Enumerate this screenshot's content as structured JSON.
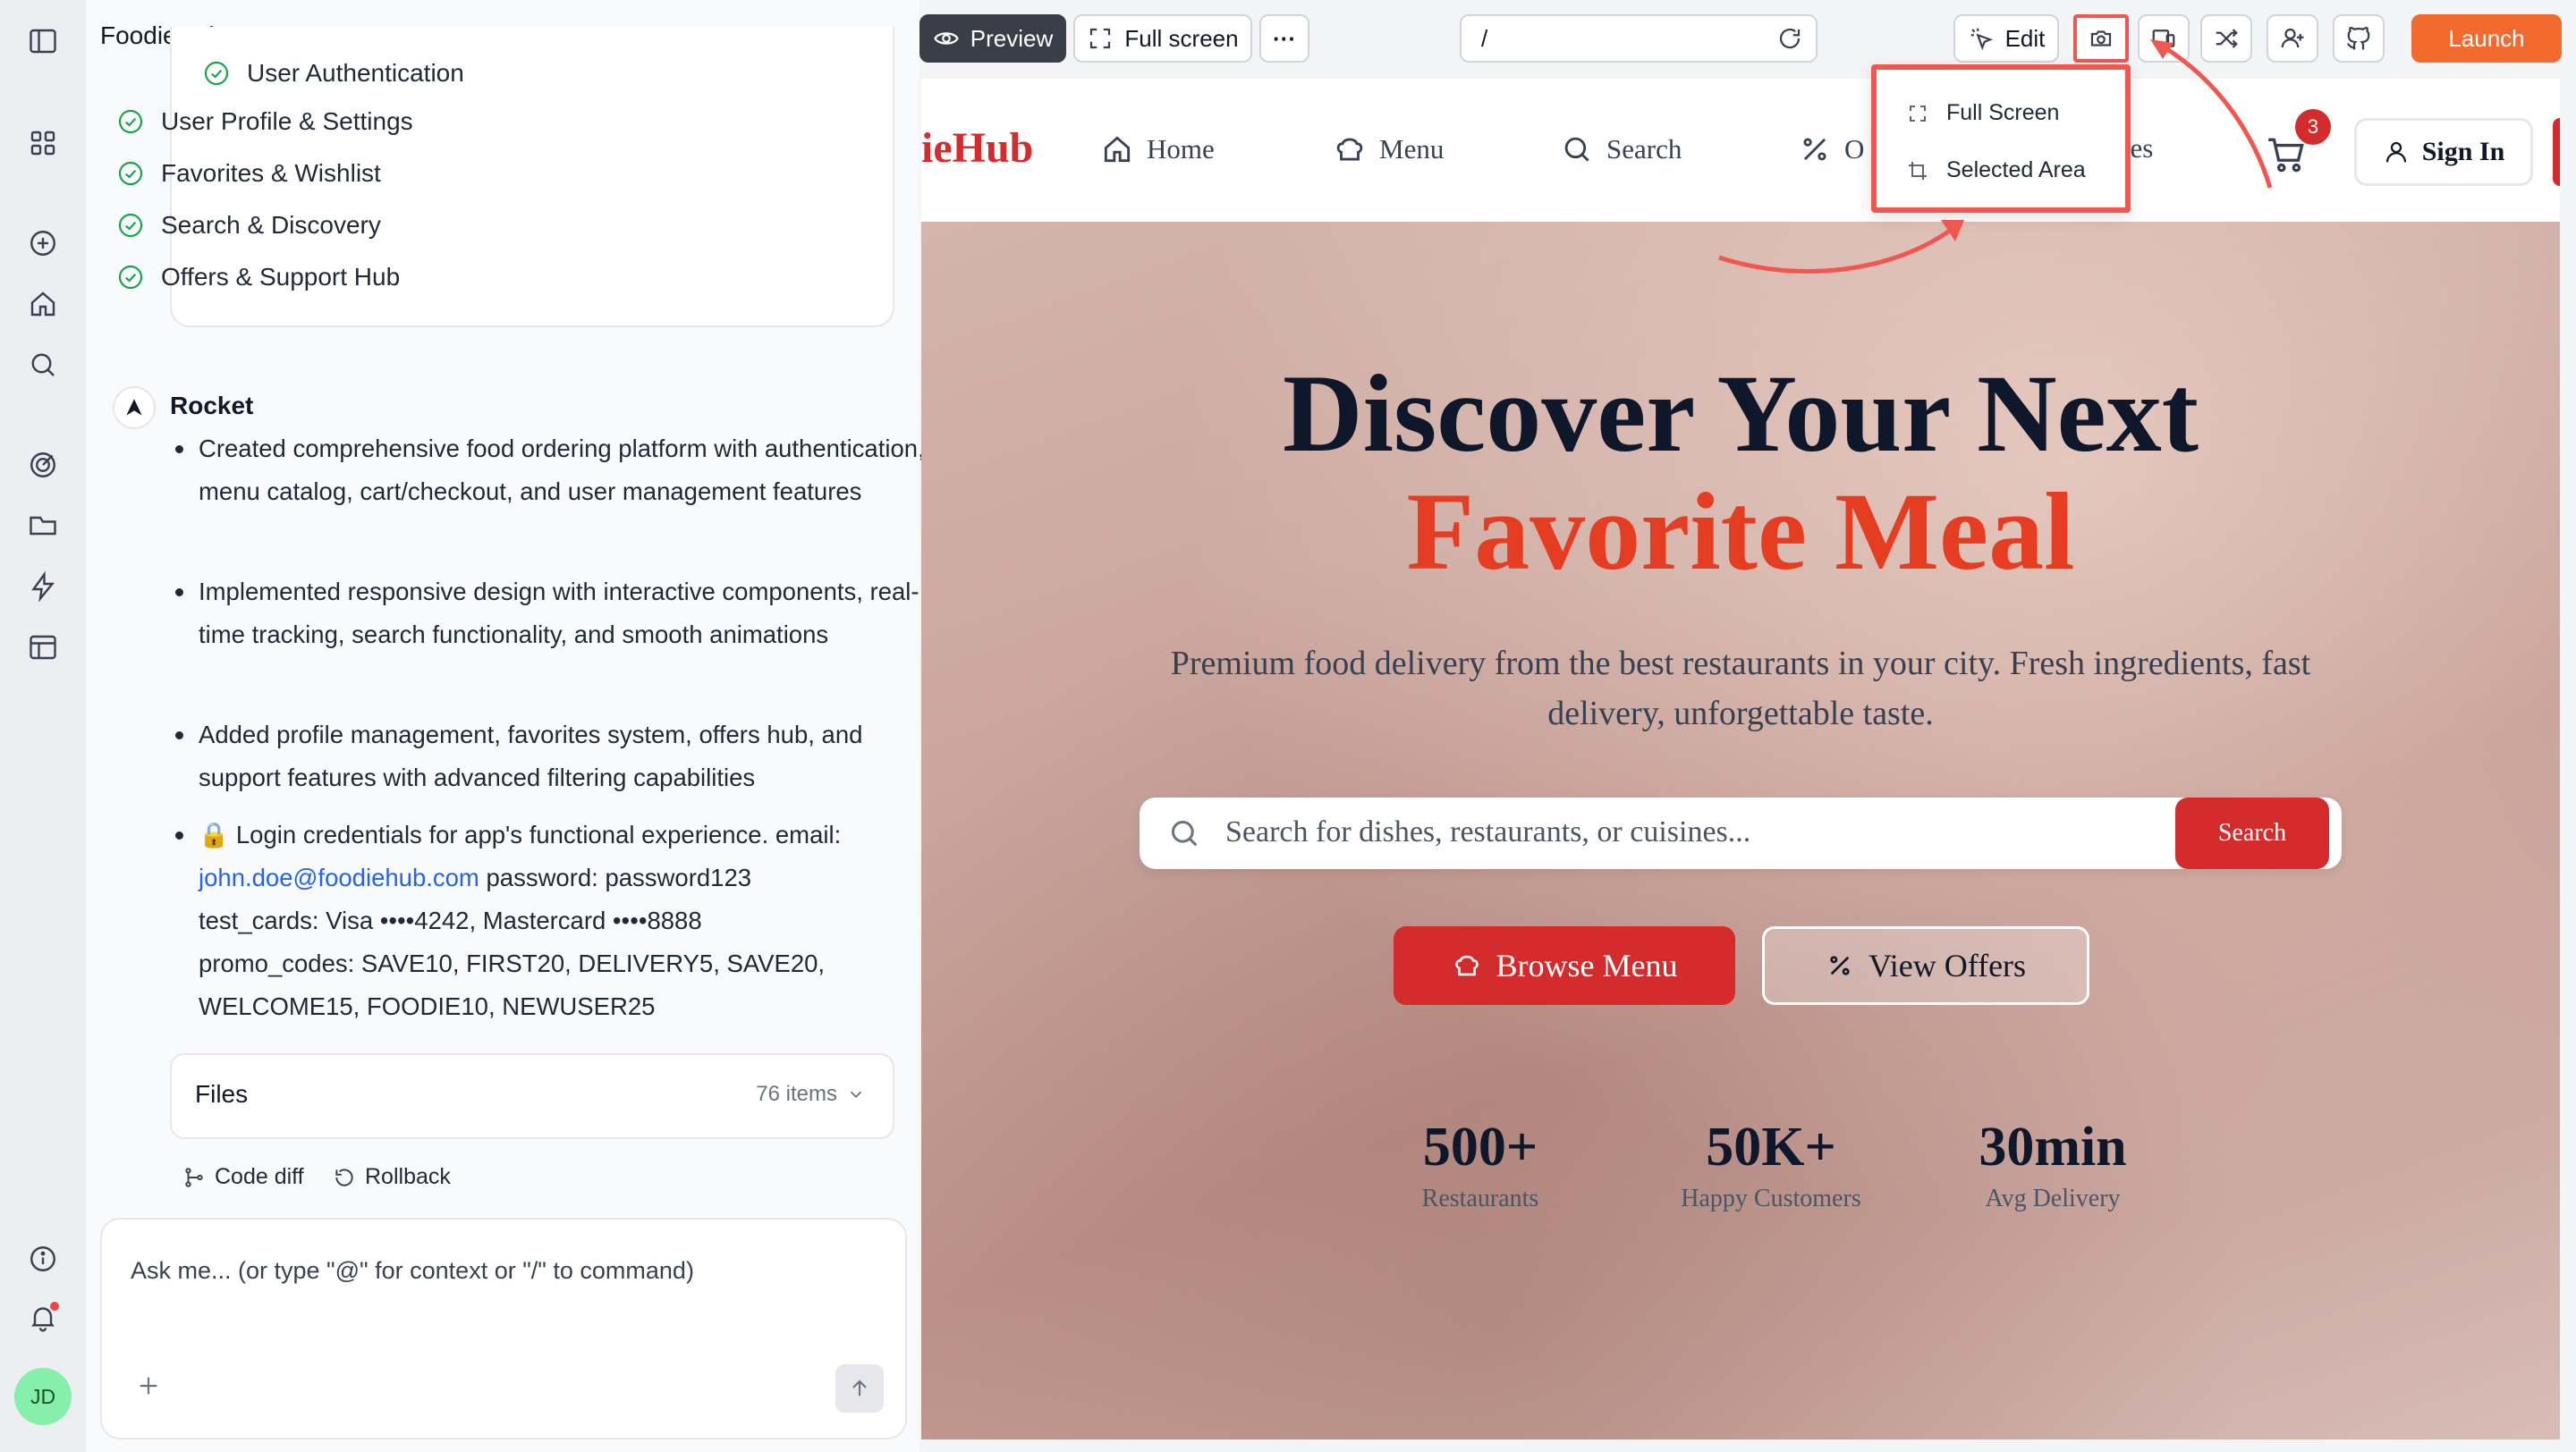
{
  "app": {
    "project_name": "FoodieHub",
    "user_initials": "JD"
  },
  "checklist": [
    "User Authentication",
    "User Profile & Settings",
    "Favorites & Wishlist",
    "Search & Discovery",
    "Offers & Support Hub"
  ],
  "assistant": {
    "name": "Rocket",
    "bullets": [
      "Created comprehensive food ordering platform with authentication, menu catalog, cart/checkout, and user management features",
      "Implemented responsive design with interactive components, real-time tracking, search functionality, and smooth animations",
      "Added profile management, favorites system, offers hub, and support features with advanced filtering capabilities"
    ],
    "credentials": {
      "emoji": "🔒",
      "prefix": "Login credentials for app's functional experience. email: ",
      "email": "john.doe@foodiehub.com",
      "rest_1": " password: password123",
      "rest_2": "test_cards: Visa ••••4242, Mastercard ••••8888",
      "rest_3": "promo_codes: SAVE10, FIRST20, DELIVERY5, SAVE20,",
      "rest_4": "WELCOME15, FOODIE10, NEWUSER25"
    }
  },
  "files": {
    "label": "Files",
    "count": "76 items"
  },
  "actions": {
    "code_diff": "Code diff",
    "rollback": "Rollback"
  },
  "composer": {
    "placeholder": "Ask me... (or type \"@\" for context or \"/\" to command)"
  },
  "toolbar": {
    "preview": "Preview",
    "full_screen": "Full screen",
    "more": "···",
    "url": "/",
    "edit": "Edit",
    "launch": "Launch"
  },
  "screenshot_menu": {
    "items": [
      "Full Screen",
      "Selected Area"
    ]
  },
  "site": {
    "logo": "ieHub",
    "nav": [
      "Home",
      "Menu",
      "Search",
      "O",
      "rites"
    ],
    "cart_count": "3",
    "sign_in": "Sign In",
    "hero_line1": "Discover Your Next",
    "hero_line2": "Favorite Meal",
    "subtitle_1": "Premium food delivery from the best restaurants in your city. Fresh ingredients, fast",
    "subtitle_2": "delivery, unforgettable taste.",
    "search_placeholder": "Search for dishes, restaurants, or cuisines...",
    "search_button": "Search",
    "browse_menu": "Browse Menu",
    "view_offers": "View Offers",
    "stats": [
      {
        "value": "500+",
        "label": "Restaurants"
      },
      {
        "value": "50K+",
        "label": "Happy Customers"
      },
      {
        "value": "30min",
        "label": "Avg Delivery"
      }
    ]
  },
  "colors": {
    "accent_orange": "#f26a2e",
    "brand_red": "#d42c2c",
    "highlight": "#f0584f",
    "dark_button": "#3a3f47"
  }
}
